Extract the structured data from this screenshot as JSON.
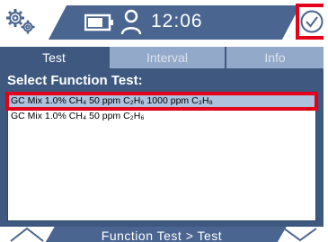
{
  "status_bar": {
    "time": "12:06",
    "icons": [
      "gears-icon",
      "battery-icon",
      "user-icon",
      "check-circle-icon"
    ]
  },
  "tabs": [
    {
      "label": "Test",
      "active": true
    },
    {
      "label": "Interval",
      "active": false
    },
    {
      "label": "Info",
      "active": false
    }
  ],
  "section_title": "Select Function Test:",
  "function_tests": [
    {
      "label": "GC Mix 1.0% CH₄ 50 ppm C₂H₆ 1000 ppm C₃H₈",
      "selected": true
    },
    {
      "label": "GC Mix 1.0% CH₄ 50 ppm C₂H₆",
      "selected": false
    }
  ],
  "footer": {
    "breadcrumb": "Function Test > Test",
    "left_icon": "chevron-up-icon",
    "right_icon": "chevron-down-icon"
  },
  "colors": {
    "brand_blue": "#4a6590",
    "panel_blue": "#3e5880",
    "tab_inactive": "#93a9c9",
    "selection": "#aec1dd",
    "highlight_red": "#e3001b"
  }
}
